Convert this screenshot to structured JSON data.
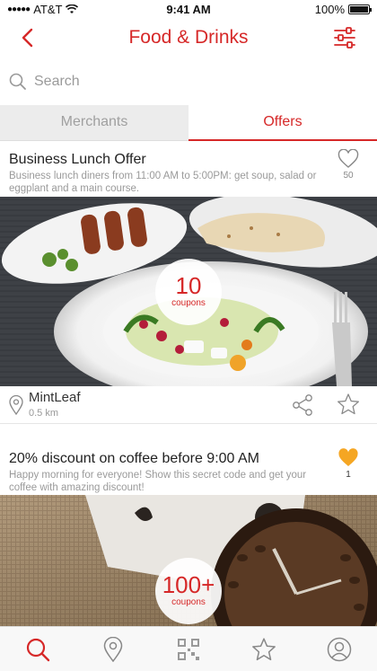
{
  "status_bar": {
    "carrier": "AT&T",
    "time": "9:41 AM",
    "battery": "100%",
    "battery_level": 1.0
  },
  "header": {
    "title": "Food & Drinks",
    "back_icon": "chevron-left-icon",
    "filter_icon": "sliders-icon"
  },
  "search": {
    "placeholder": "Search",
    "value": ""
  },
  "tabs": [
    {
      "label": "Merchants",
      "active": false
    },
    {
      "label": "Offers",
      "active": true
    }
  ],
  "offers": [
    {
      "title": "Business Lunch Offer",
      "description": "Business lunch diners from 11:00 AM to 5:00PM: get soup, salad or eggplant and a main course.",
      "likes": "50",
      "liked": false,
      "coupons": "10",
      "coupons_label": "coupons",
      "merchant": "MintLeaf",
      "distance": "0.5 km"
    },
    {
      "title": "20% discount on coffee before 9:00 AM",
      "description": "Happy morning for everyone! Show this secret code and get your coffee with amazing discount!",
      "likes": "1",
      "liked": true,
      "coupons": "100+",
      "coupons_label": "coupons"
    }
  ],
  "bottom_tabs": [
    "search-icon",
    "location-pin-icon",
    "qr-code-icon",
    "star-icon",
    "profile-icon"
  ],
  "colors": {
    "accent": "#d62828",
    "liked": "#f5a623",
    "tabbar_bg": "#f8f8f8"
  }
}
